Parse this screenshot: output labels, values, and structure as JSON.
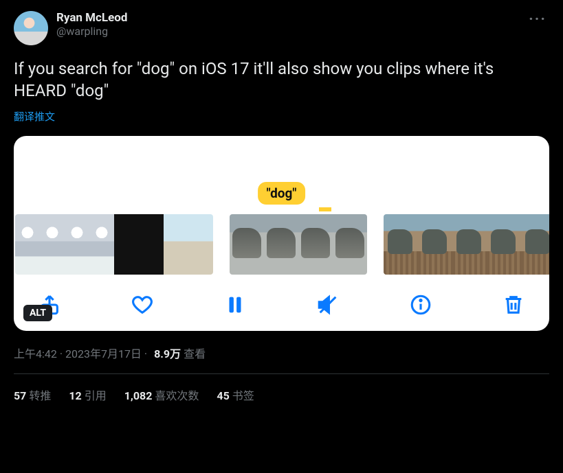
{
  "author": {
    "display_name": "Ryan McLeod",
    "handle": "@warpling"
  },
  "tweet_text": "If you search for \"dog\" on iOS 17 it'll also show you clips where it's HEARD \"dog\"",
  "translate_label": "翻译推文",
  "media": {
    "chip_text": "\"dog\"",
    "alt_badge": "ALT",
    "toolbar_icons": [
      "share-icon",
      "heart-icon",
      "pause-icon",
      "mute-icon",
      "info-icon",
      "trash-icon"
    ]
  },
  "meta": {
    "time": "上午4:42",
    "dot": " · ",
    "date": "2023年7月17日",
    "views_count": "8.9万",
    "views_label": "查看"
  },
  "stats": {
    "retweets_count": "57",
    "retweets_label": "转推",
    "quotes_count": "12",
    "quotes_label": "引用",
    "likes_count": "1,082",
    "likes_label": "喜欢次数",
    "bookmarks_count": "45",
    "bookmarks_label": "书签"
  }
}
